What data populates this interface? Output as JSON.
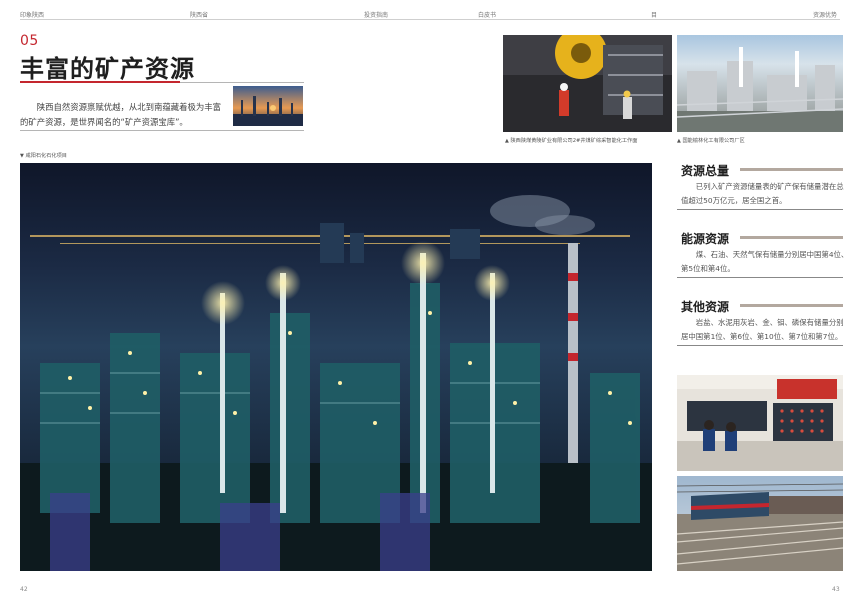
{
  "header": {
    "left_mark": "印象陕西",
    "items": [
      "陕西省",
      "投资指南",
      "白皮书",
      "目",
      "资源优势"
    ]
  },
  "section": {
    "number": "05",
    "title": "丰富的矿产资源",
    "intro": "陕西自然资源禀赋优越，从北到南蕴藏着极为丰富的矿产资源，是世界闻名的“矿产资源宝库”。"
  },
  "captions": {
    "main_photo": "咸阳石化石化项目",
    "top_photo_1": "陕西陕煤黄陵矿业有限公司2#井煤矿综采智能化工作面",
    "top_photo_2": "国能榆林化工有限公司厂区"
  },
  "stats": [
    {
      "title": "资源总量",
      "body": "已列入矿产资源储量表的矿产保有储量潜在总值超过50万亿元，居全国之首。"
    },
    {
      "title": "能源资源",
      "body": "煤、石油、天然气保有储量分别居中国第4位、第5位和第4位。"
    },
    {
      "title": "其他资源",
      "body": "岩盐、水泥用灰岩、金、钼、磷保有储量分别居中国第1位、第6位、第10位、第7位和第7位。"
    }
  ],
  "folios": {
    "left": "42",
    "right": "43"
  },
  "colors": {
    "accent_red": "#c4262e",
    "stat_bar": "#b3a89f"
  }
}
